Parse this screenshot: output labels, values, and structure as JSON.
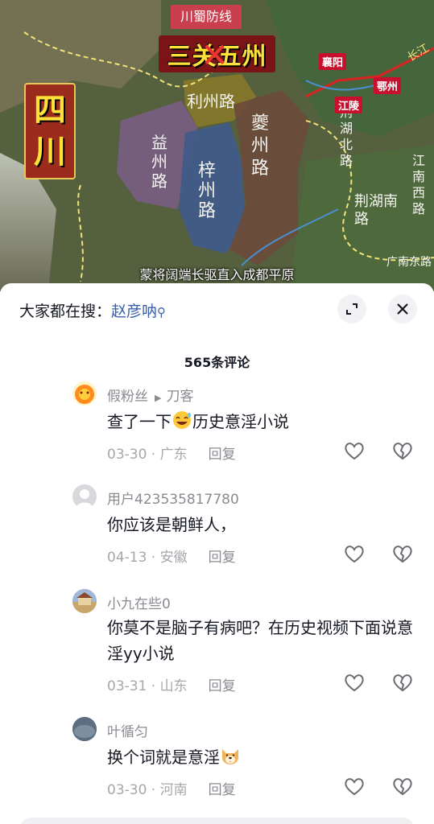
{
  "video": {
    "title_tag": "川蜀防线",
    "banner_text": "三关五州",
    "side_title": [
      "四",
      "川"
    ],
    "subtitle": "蒙将阔端长驱直入成都平原",
    "cities": [
      "襄阳",
      "江陵",
      "鄂州"
    ],
    "regions": [
      "利州路",
      "益州路",
      "梓州路",
      "夔州路",
      "荆湖北路",
      "荆湖南路",
      "江南西路",
      "广南东路"
    ],
    "river_label": "长江",
    "colors": {
      "lizhou": "#8a7a28",
      "yizhou": "#7b5e86",
      "zizhou": "#3f5b8c",
      "kuizhou": "#6b4a3a"
    }
  },
  "sheet": {
    "search_prefix": "大家都在搜：",
    "search_keyword": "赵彦呐",
    "expand_icon": "expand-icon",
    "close_icon": "close-icon",
    "count_label": "565条评论"
  },
  "comments": [
    {
      "user": "假粉丝",
      "reply_to": "刀客",
      "text_before": "查了一下",
      "emoji": "laugh-sweat-emoji",
      "text_after": "历史意淫小说",
      "date": "03-30",
      "location": "广东",
      "reply": "回复"
    },
    {
      "user": "用户423535817780",
      "text": "你应该是朝鲜人，",
      "date": "04-13",
      "location": "安徽",
      "reply": "回复"
    },
    {
      "user": "小九在些0",
      "text": "你莫不是脑子有病吧？在历史视频下面说意淫yy小说",
      "date": "03-31",
      "location": "山东",
      "reply": "回复"
    },
    {
      "user": "叶循匀",
      "text_before": "换个词就是意淫",
      "emoji": "dog-emoji",
      "date": "03-30",
      "location": "河南",
      "reply": "回复"
    }
  ],
  "colors": {
    "text": "#161823",
    "secondary": "#8a8b91",
    "link": "#3a5faa",
    "accent_red": "#c93f4e"
  }
}
